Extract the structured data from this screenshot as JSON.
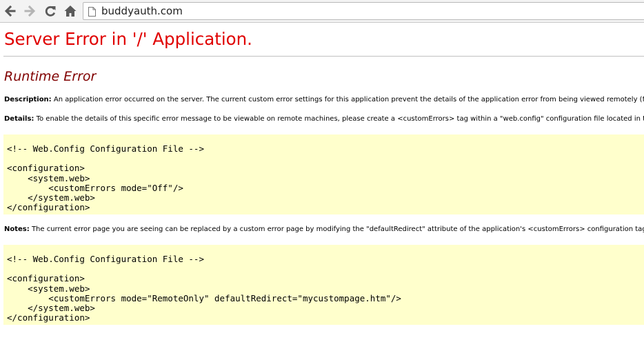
{
  "browser": {
    "url": "buddyauth.com"
  },
  "page": {
    "title": "Server Error in '/' Application.",
    "subtitle": "Runtime Error",
    "description_label": "Description:",
    "description_text": " An application error occurred on the server. The current custom error settings for this application prevent the details of the application error from being viewed remotely (for se",
    "details_label": "Details:",
    "details_text": " To enable the details of this specific error message to be viewable on remote machines, please create a <customErrors> tag within a \"web.config\" configuration file located in the roo",
    "notes_label": "Notes:",
    "notes_text": " The current error page you are seeing can be replaced by a custom error page by modifying the \"defaultRedirect\" attribute of the application's <customErrors> configuration tag to point",
    "code1": "<!-- Web.Config Configuration File -->\n\n<configuration>\n    <system.web>\n        <customErrors mode=\"Off\"/>\n    </system.web>\n</configuration>",
    "code2": "<!-- Web.Config Configuration File -->\n\n<configuration>\n    <system.web>\n        <customErrors mode=\"RemoteOnly\" defaultRedirect=\"mycustompage.htm\"/>\n    </system.web>\n</configuration>"
  },
  "icons": {
    "back": "back-arrow-icon",
    "forward": "forward-arrow-icon",
    "reload": "reload-icon",
    "home": "home-icon",
    "page": "page-icon"
  }
}
